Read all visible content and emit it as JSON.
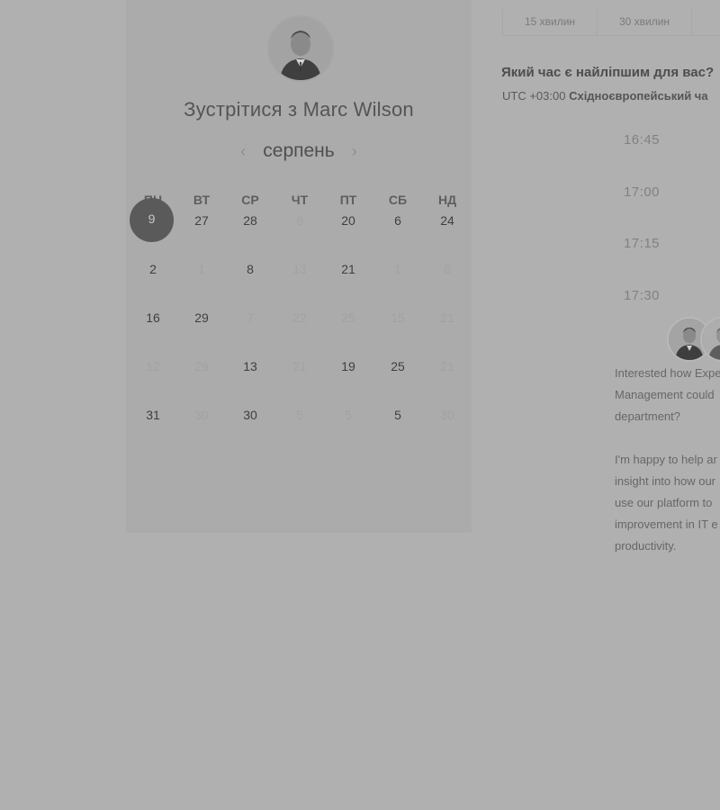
{
  "meeting": {
    "title": "Зустрітися з Marc Wilson",
    "host_avatar_icon": "person-avatar-icon"
  },
  "calendar": {
    "month": "серпень",
    "prev_icon": "chevron-left-icon",
    "next_icon": "chevron-right-icon",
    "weekdays": [
      "ПН",
      "ВТ",
      "СР",
      "ЧТ",
      "ПТ",
      "СБ",
      "НД"
    ],
    "selected_day": "9",
    "rows": [
      [
        "9",
        "27",
        "28",
        "8",
        "20",
        "6",
        "24"
      ],
      [
        "2",
        "1",
        "8",
        "13",
        "21",
        "1",
        "8"
      ],
      [
        "16",
        "29",
        "7",
        "22",
        "25",
        "15",
        "21"
      ],
      [
        "12",
        "29",
        "13",
        "21",
        "19",
        "25",
        "21"
      ],
      [
        "31",
        "30",
        "30",
        "5",
        "5",
        "5",
        "30"
      ]
    ],
    "active_pattern": [
      [
        true,
        true,
        true,
        false,
        true,
        true,
        true
      ],
      [
        true,
        false,
        true,
        false,
        true,
        false,
        false
      ],
      [
        true,
        true,
        false,
        false,
        false,
        false,
        false
      ],
      [
        false,
        false,
        true,
        false,
        true,
        true,
        false
      ],
      [
        true,
        false,
        true,
        false,
        false,
        true,
        false
      ]
    ]
  },
  "durations": [
    "15 хвилин",
    "30 хвилин"
  ],
  "question": "Який час є найліпшим для вас?",
  "timezone": {
    "offset": "UTC +03:00",
    "name": "Східноєвропейський ча"
  },
  "time_slots": [
    "16:45",
    "17:00",
    "17:15",
    "17:30"
  ],
  "description": {
    "p1": "Interested how Expe Management could department?",
    "p1_lines": [
      "Interested how Expe",
      "Management could",
      "department?"
    ],
    "p2_lines": [
      "I'm happy to help ar",
      "insight into how our",
      "use our platform to",
      "improvement in IT e",
      "productivity."
    ]
  },
  "colors": {
    "overlay": "#b0b0b0",
    "selected_day": "#5a5a5a"
  }
}
